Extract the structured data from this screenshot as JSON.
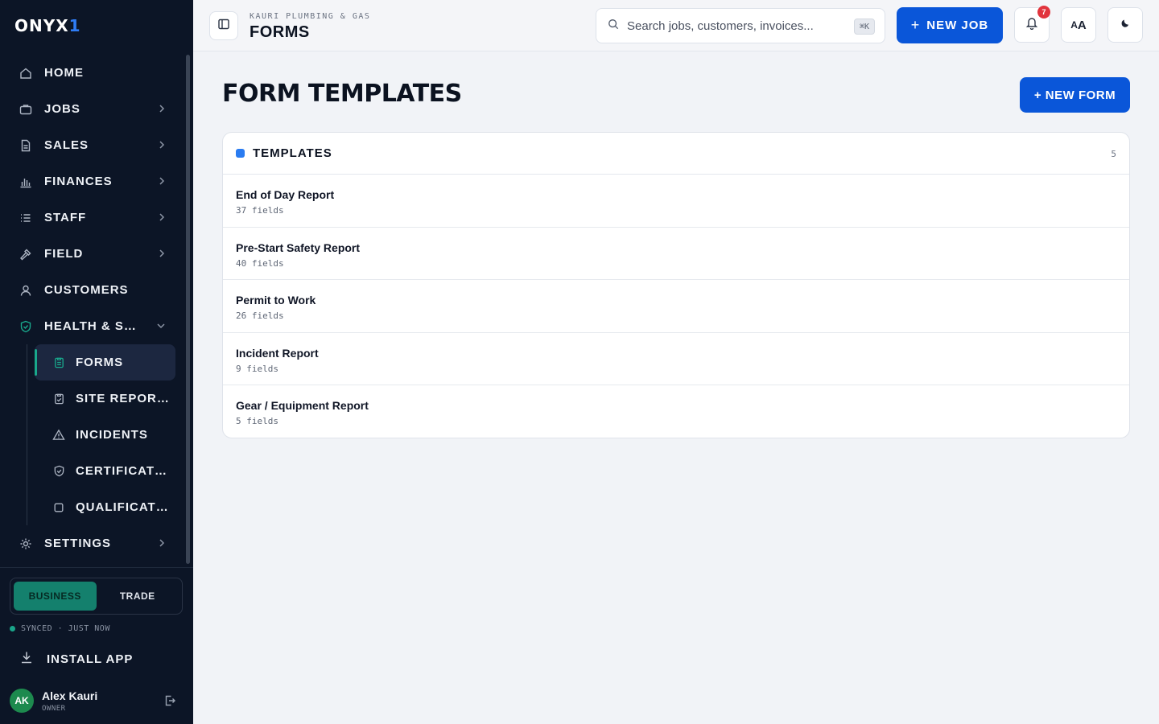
{
  "brand": {
    "name": "ONYX",
    "mark": "1",
    "accent": "#2f7df6"
  },
  "sidebar": {
    "items": [
      {
        "label": "HOME",
        "icon": "home-icon",
        "expandable": false
      },
      {
        "label": "JOBS",
        "icon": "briefcase-icon",
        "expandable": true
      },
      {
        "label": "SALES",
        "icon": "document-icon",
        "expandable": true
      },
      {
        "label": "FINANCES",
        "icon": "bar-chart-icon",
        "expandable": true
      },
      {
        "label": "STAFF",
        "icon": "list-icon",
        "expandable": true
      },
      {
        "label": "FIELD",
        "icon": "hammer-icon",
        "expandable": true
      },
      {
        "label": "CUSTOMERS",
        "icon": "user-icon",
        "expandable": false
      },
      {
        "label": "HEALTH & SAFETY",
        "icon": "shield-check-icon",
        "expandable": true,
        "expanded": true
      }
    ],
    "sub_items": [
      {
        "label": "FORMS",
        "icon": "clipboard-icon",
        "active": true
      },
      {
        "label": "SITE REPORTS",
        "icon": "clipboard-check-icon",
        "active": false
      },
      {
        "label": "INCIDENTS",
        "icon": "warning-icon",
        "active": false
      },
      {
        "label": "CERTIFICATIONS",
        "icon": "shield-icon",
        "active": false
      },
      {
        "label": "QUALIFICATIONS",
        "icon": "square-icon",
        "active": false
      }
    ],
    "settings_label": "SETTINGS",
    "mode_toggle": {
      "business": "BUSINESS",
      "trade": "TRADE",
      "selected": "BUSINESS"
    },
    "sync_status": "SYNCED · JUST NOW",
    "install_label": "INSTALL APP",
    "user": {
      "initials": "AK",
      "name": "Alex Kauri",
      "role": "OWNER"
    }
  },
  "topbar": {
    "org": "KAURI PLUMBING & GAS",
    "title": "FORMS",
    "search_placeholder": "Search jobs, customers, invoices...",
    "search_shortcut": "⌘K",
    "new_job_label": "NEW JOB",
    "new_job_plus": "+",
    "notification_count": "7",
    "font_size_label": "A",
    "font_size_label_large": "A"
  },
  "main": {
    "title": "FORM TEMPLATES",
    "new_form_label": "+ NEW FORM",
    "templates": {
      "heading": "TEMPLATES",
      "count": "5",
      "rows": [
        {
          "name": "End of Day Report",
          "fields": "37 fields"
        },
        {
          "name": "Pre-Start Safety Report",
          "fields": "40 fields"
        },
        {
          "name": "Permit to Work",
          "fields": "26 fields"
        },
        {
          "name": "Incident Report",
          "fields": "9 fields"
        },
        {
          "name": "Gear / Equipment Report",
          "fields": "5 fields"
        }
      ]
    }
  },
  "colors": {
    "sidebar_bg": "#0c1526",
    "primary": "#0a56d9",
    "teal": "#19a88c",
    "badge": "#e1343d"
  }
}
